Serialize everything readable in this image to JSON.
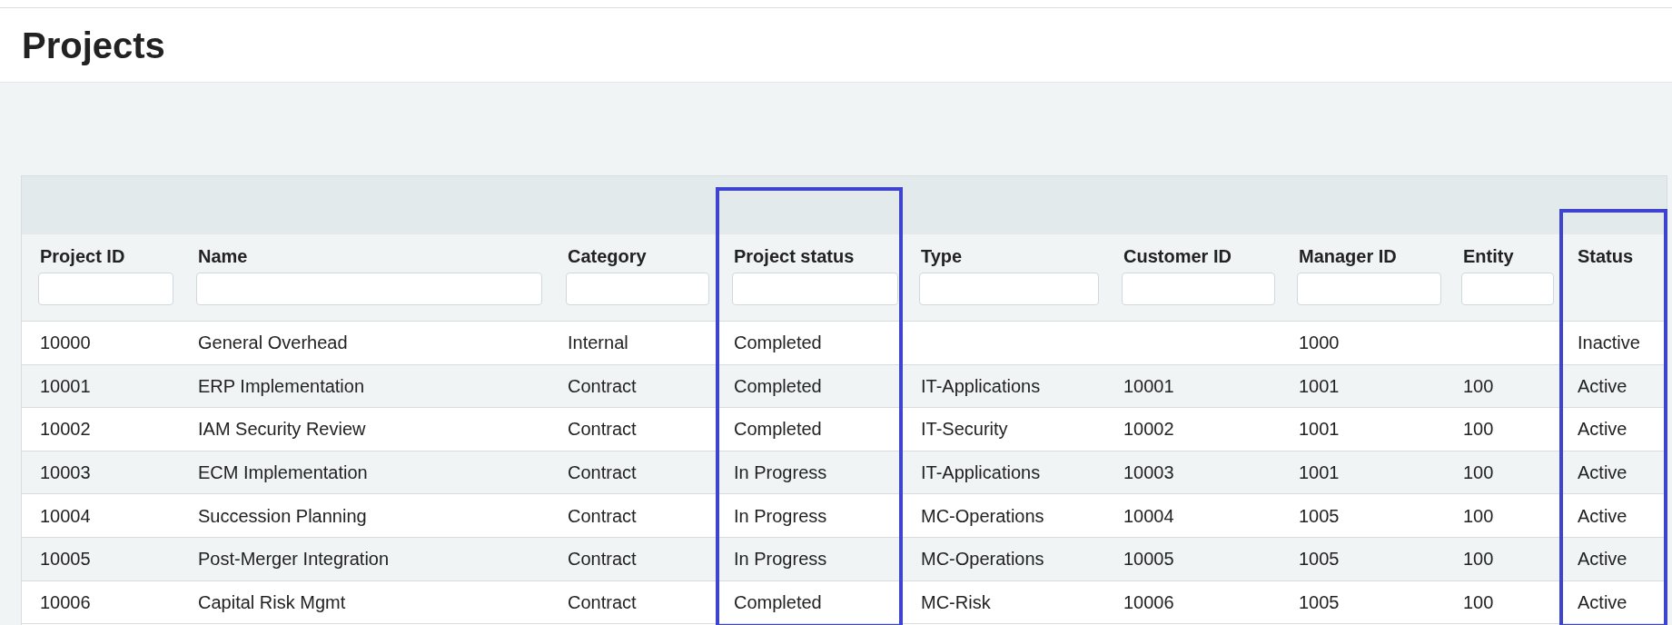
{
  "page": {
    "title": "Projects"
  },
  "table": {
    "columns": [
      {
        "label": "Project ID",
        "filter": true,
        "highlighted": false
      },
      {
        "label": "Name",
        "filter": true,
        "highlighted": false
      },
      {
        "label": "Category",
        "filter": true,
        "highlighted": false
      },
      {
        "label": "Project status",
        "filter": true,
        "highlighted": true
      },
      {
        "label": "Type",
        "filter": true,
        "highlighted": false
      },
      {
        "label": "Customer ID",
        "filter": true,
        "highlighted": false
      },
      {
        "label": "Manager ID",
        "filter": true,
        "highlighted": false
      },
      {
        "label": "Entity",
        "filter": true,
        "highlighted": false
      },
      {
        "label": "Status",
        "filter": false,
        "highlighted": true
      }
    ],
    "rows": [
      [
        "10000",
        "General Overhead",
        "Internal",
        "Completed",
        null,
        null,
        "1000",
        null,
        "Inactive"
      ],
      [
        "10001",
        "ERP Implementation",
        "Contract",
        "Completed",
        "IT-Applications",
        "10001",
        "1001",
        "100",
        "Active"
      ],
      [
        "10002",
        "IAM Security Review",
        "Contract",
        "Completed",
        "IT-Security",
        "10002",
        "1001",
        "100",
        "Active"
      ],
      [
        "10003",
        "ECM Implementation",
        "Contract",
        "In Progress",
        "IT-Applications",
        "10003",
        "1001",
        "100",
        "Active"
      ],
      [
        "10004",
        "Succession Planning",
        "Contract",
        "In Progress",
        "MC-Operations",
        "10004",
        "1005",
        "100",
        "Active"
      ],
      [
        "10005",
        "Post-Merger Integration",
        "Contract",
        "In Progress",
        "MC-Operations",
        "10005",
        "1005",
        "100",
        "Active"
      ],
      [
        "10006",
        "Capital Risk Mgmt",
        "Contract",
        "Completed",
        "MC-Risk",
        "10006",
        "1005",
        "100",
        "Active"
      ]
    ]
  }
}
